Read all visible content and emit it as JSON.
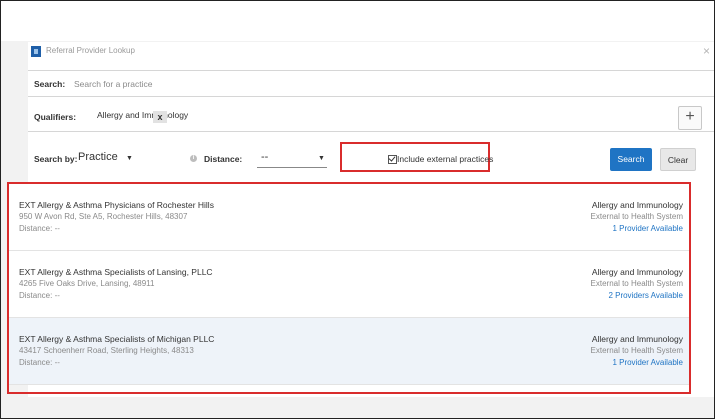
{
  "dialog": {
    "title": "Referral Provider Lookup",
    "close_glyph": "×"
  },
  "search": {
    "label": "Search:",
    "placeholder": "Search for a practice"
  },
  "qualifiers": {
    "label": "Qualifiers:",
    "chips": [
      {
        "label": "Allergy and Immunology",
        "remove_glyph": "x"
      }
    ],
    "add_glyph": "+"
  },
  "filters": {
    "search_by_label": "Search by:",
    "search_by_value": "Practice",
    "distance_label": "Distance:",
    "distance_value": "--",
    "include_external_label": "Include external practices",
    "include_external_checked": true
  },
  "buttons": {
    "search": "Search",
    "clear": "Clear"
  },
  "results": [
    {
      "name": "EXT Allergy & Asthma Physicians of Rochester Hills",
      "address": "950 W Avon Rd, Ste A5, Rochester Hills, 48307",
      "distance": "Distance: --",
      "specialty": "Allergy and Immunology",
      "network": "External to Health System",
      "availability": "1 Provider Available"
    },
    {
      "name": "EXT Allergy & Asthma Specialists of Lansing, PLLC",
      "address": "4265 Five Oaks Drive, Lansing, 48911",
      "distance": "Distance: --",
      "specialty": "Allergy and Immunology",
      "network": "External to Health System",
      "availability": "2 Providers Available"
    },
    {
      "name": "EXT Allergy & Asthma Specialists of Michigan PLLC",
      "address": "43417 Schoenherr Road, Sterling Heights, 48313",
      "distance": "Distance: --",
      "specialty": "Allergy and Immunology",
      "network": "External to Health System",
      "availability": "1 Provider Available"
    }
  ],
  "colors": {
    "accent_blue": "#1f74c4",
    "highlight_red": "#d92c2c",
    "selected_row": "#eef3f9"
  }
}
